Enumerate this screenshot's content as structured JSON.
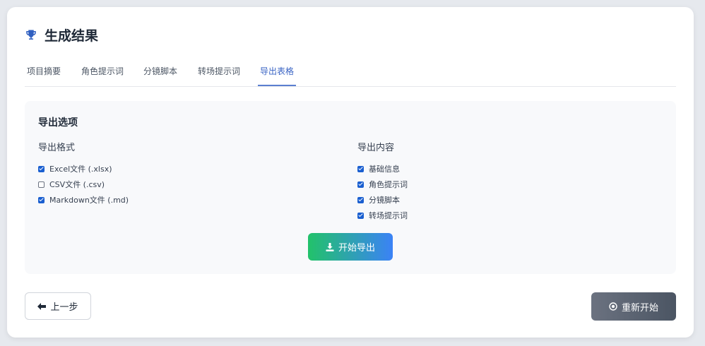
{
  "header": {
    "title": "生成结果",
    "icon": "trophy-icon"
  },
  "tabs": [
    {
      "label": "项目摘要",
      "active": false
    },
    {
      "label": "角色提示词",
      "active": false
    },
    {
      "label": "分镜脚本",
      "active": false
    },
    {
      "label": "转场提示词",
      "active": false
    },
    {
      "label": "导出表格",
      "active": true
    }
  ],
  "panel": {
    "title": "导出选项",
    "format": {
      "title": "导出格式",
      "options": [
        {
          "label": "Excel文件 (.xlsx)",
          "checked": true
        },
        {
          "label": "CSV文件 (.csv)",
          "checked": false
        },
        {
          "label": "Markdown文件 (.md)",
          "checked": true
        }
      ]
    },
    "content": {
      "title": "导出内容",
      "options": [
        {
          "label": "基础信息",
          "checked": true
        },
        {
          "label": "角色提示词",
          "checked": true
        },
        {
          "label": "分镜脚本",
          "checked": true
        },
        {
          "label": "转场提示词",
          "checked": true
        }
      ]
    },
    "export_button": {
      "label": "开始导出",
      "icon": "download-icon"
    }
  },
  "footer": {
    "prev_button": {
      "label": "上一步",
      "icon": "arrow-left-icon"
    },
    "restart_button": {
      "label": "重新开始",
      "icon": "restart-icon"
    }
  },
  "colors": {
    "accent": "#3a64c4",
    "checkbox": "#1a5fd0",
    "export_gradient_start": "#22c26a",
    "export_gradient_end": "#3b82f6",
    "restart_gradient_start": "#6b7280",
    "restart_gradient_end": "#4b5563"
  }
}
